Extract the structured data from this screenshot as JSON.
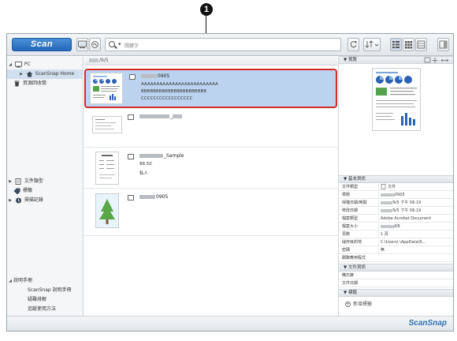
{
  "callout": {
    "number": "1"
  },
  "toolbar": {
    "scan_label": "Scan",
    "search_placeholder": "關鍵字"
  },
  "sidebar": {
    "pc": "PC",
    "home": "ScanSnap Home",
    "trash": "資源回收筒",
    "doc_types": "文件類型",
    "tags": "標籤",
    "history": "掃描記錄",
    "help": "說明手冊",
    "manual": "ScanSnap 說明手冊",
    "glossary": "疑難排解",
    "howto": "追蹤使用方法"
  },
  "path": {
    "text": "/9/5"
  },
  "files": [
    {
      "name": "0905",
      "lines": [
        "AAAAAAAAAAAAAAAAAAAAAAAAA",
        "BBBBBBBBBBBBBBBBBBBBBB",
        "CCCCCCCCCCCCCCCCC"
      ]
    },
    {
      "name": "_",
      "lines": []
    },
    {
      "name": "_Sample",
      "lines": [
        "88,50",
        "私人"
      ]
    },
    {
      "name": "0905",
      "lines": []
    }
  ],
  "info": {
    "preview_header": "預覽",
    "basic_header": "基本資訊",
    "props": [
      {
        "k": "文件類型",
        "v": "文件"
      },
      {
        "k": "標題",
        "v": "0905"
      },
      {
        "k": "掃描日期/時間",
        "v": "/9/5 下午 06:19"
      },
      {
        "k": "修改日期",
        "v": "/9/5 下午 06:19"
      },
      {
        "k": "檔案類型",
        "v": "Adobe Acrobat Document"
      },
      {
        "k": "檔案大小",
        "v": "KB"
      },
      {
        "k": "頁數",
        "v": "1 頁"
      },
      {
        "k": "儲存目的地",
        "v": "C:\\Users\\        \\AppData\\R..."
      },
      {
        "k": "密碼",
        "v": "無"
      },
      {
        "k": "關聯應用程式",
        "v": ""
      }
    ],
    "doc_info_header": "文件資訊",
    "doc_props": [
      {
        "k": "備忘錄",
        "v": ""
      },
      {
        "k": "文件日期",
        "v": ""
      }
    ],
    "tags_header": "標籤",
    "add_tag": "新增標籤"
  },
  "brand": "ScanSnap"
}
